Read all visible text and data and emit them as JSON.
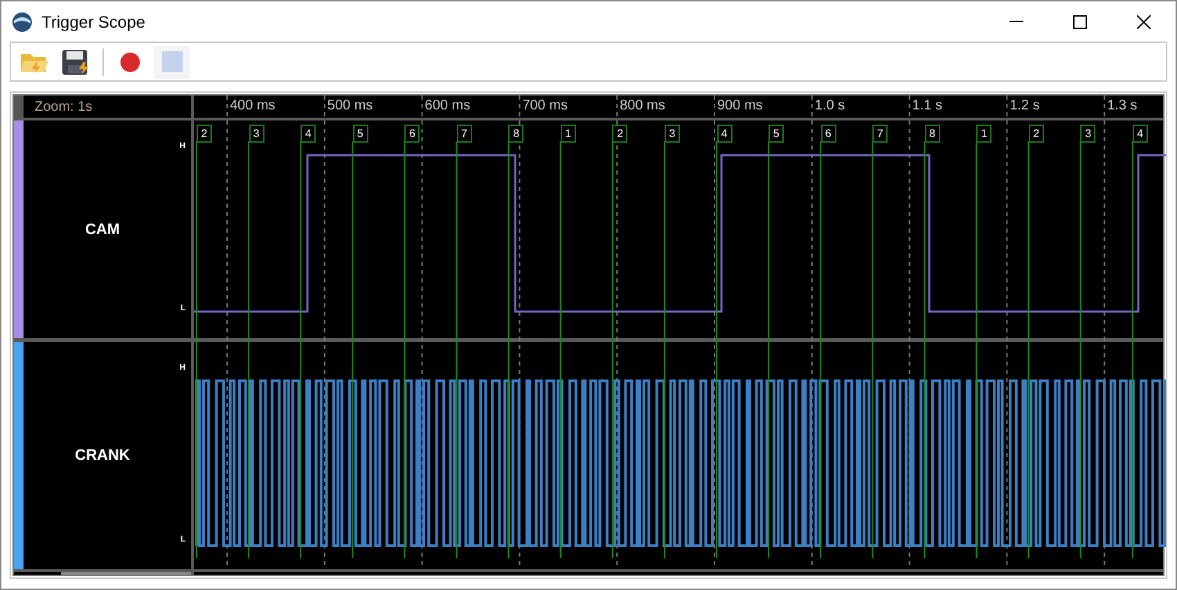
{
  "window": {
    "title": "Trigger Scope"
  },
  "toolbar": [
    {
      "kind": "open",
      "disabled": false
    },
    {
      "kind": "save",
      "disabled": false
    },
    {
      "kind": "record",
      "disabled": false
    },
    {
      "kind": "stop",
      "disabled": true
    }
  ],
  "zoom_label": "Zoom: 1s",
  "time_ticks": [
    "400 ms",
    "500 ms",
    "600 ms",
    "700 ms",
    "800 ms",
    "900 ms",
    "1.0 s",
    "1.1 s",
    "1.2 s",
    "1.3 s"
  ],
  "tooth_markers": [
    "2",
    "3",
    "4",
    "5",
    "6",
    "7",
    "8",
    "1",
    "2",
    "3",
    "4",
    "5",
    "6",
    "7",
    "8",
    "1",
    "2",
    "3",
    "4"
  ],
  "channels": [
    {
      "kind": "cam",
      "name": "CAM",
      "color": "#a98ee8",
      "high_label": "H",
      "low_label": "L"
    },
    {
      "kind": "crank",
      "name": "CRANK",
      "color": "#4aa3f0",
      "high_label": "H",
      "low_label": "L"
    }
  ]
}
